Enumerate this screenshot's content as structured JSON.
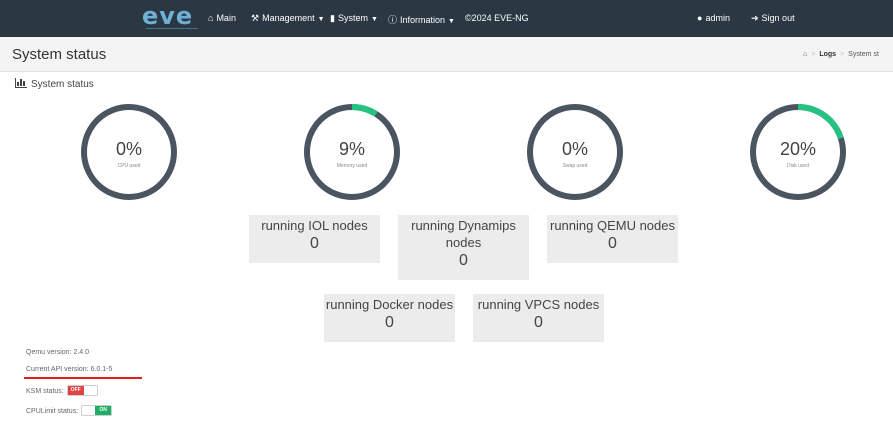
{
  "navbar": {
    "logo": "eve",
    "items": [
      {
        "label": "Main",
        "icon": "home-icon"
      },
      {
        "label": "Management",
        "icon": "wrench-icon"
      },
      {
        "label": "System",
        "icon": "book-icon"
      },
      {
        "label": "Information",
        "icon": "info-icon"
      },
      {
        "label": "©2024 EVE-NG"
      }
    ],
    "user": "admin",
    "signout": "Sign out"
  },
  "header": {
    "title": "System status",
    "breadcrumb": [
      "Logs",
      "System st"
    ]
  },
  "box": {
    "title": "System status"
  },
  "gauges": [
    {
      "value": "0%",
      "label": "CPU used",
      "percent": 0
    },
    {
      "value": "9%",
      "label": "Memory used",
      "percent": 9
    },
    {
      "value": "0%",
      "label": "Swap used",
      "percent": 0
    },
    {
      "value": "20%",
      "label": "Disk used",
      "percent": 20
    }
  ],
  "nodes": {
    "iol": {
      "title": "running IOL nodes",
      "count": "0"
    },
    "dynamips": {
      "title": "running Dynamips nodes",
      "count": "0"
    },
    "qemu": {
      "title": "running QEMU nodes",
      "count": "0"
    },
    "docker": {
      "title": "running Docker nodes",
      "count": "0"
    },
    "vpcs": {
      "title": "running VPCS nodes",
      "count": "0"
    }
  },
  "info": {
    "qemu_version": "Qemu version: 2.4.0",
    "api_version": "Current API version: 6.0.1-5",
    "ksm_status": "KSM status:",
    "ksm_toggle": "OFF",
    "cpulimit_status": "CPULimit status:",
    "cpulimit_toggle": "ON"
  },
  "colors": {
    "navbar": "#2b3843",
    "gauge_track": "#4b5560",
    "gauge_fill": "#26c281",
    "node_box": "#ececec",
    "api_underline": "#e21b1b"
  }
}
